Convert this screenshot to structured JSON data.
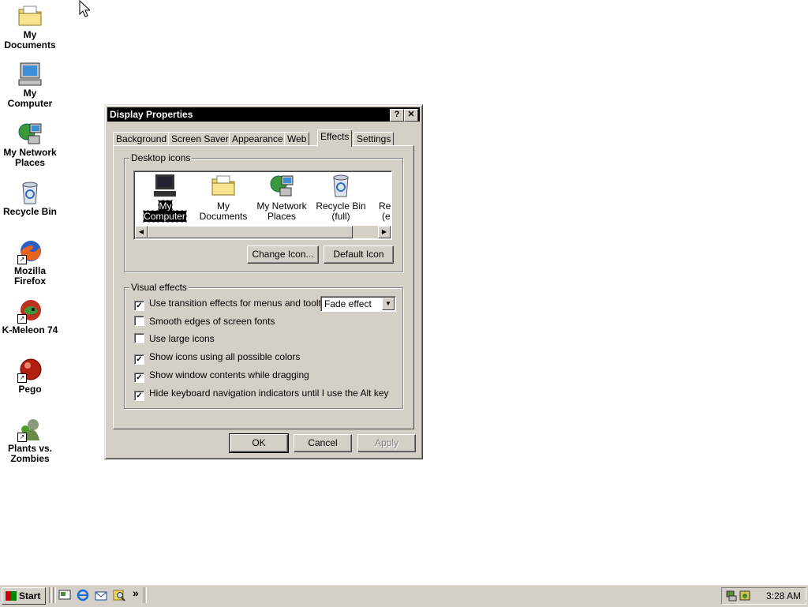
{
  "desktop": {
    "icons": [
      {
        "label_line1": "My",
        "label_line2": "Documents",
        "icon": "folder-documents-icon"
      },
      {
        "label_line1": "My",
        "label_line2": "Computer",
        "icon": "computer-icon"
      },
      {
        "label_line1": "My Network",
        "label_line2": "Places",
        "icon": "network-places-icon"
      },
      {
        "label_line1": "Recycle Bin",
        "label_line2": "",
        "icon": "recycle-bin-icon"
      },
      {
        "label_line1": "Mozilla",
        "label_line2": "Firefox",
        "icon": "firefox-icon"
      },
      {
        "label_line1": "K-Meleon 74",
        "label_line2": "",
        "icon": "kmeleon-icon"
      },
      {
        "label_line1": "Pego",
        "label_line2": "",
        "icon": "pego-icon"
      },
      {
        "label_line1": "Plants vs.",
        "label_line2": "Zombies",
        "icon": "plants-vs-zombies-icon"
      }
    ]
  },
  "dialog": {
    "title": "Display Properties",
    "help_glyph": "?",
    "close_glyph": "✕",
    "tabs": [
      "Background",
      "Screen Saver",
      "Appearance",
      "Web",
      "Effects",
      "Settings"
    ],
    "active_tab": "Effects",
    "desktop_icons": {
      "group_label": "Desktop icons",
      "items": [
        {
          "label_line1": "My Computer",
          "label_line2": "",
          "selected": true
        },
        {
          "label_line1": "My Documents",
          "label_line2": ""
        },
        {
          "label_line1": "My Network",
          "label_line2": "Places"
        },
        {
          "label_line1": "Recycle Bin",
          "label_line2": "(full)"
        },
        {
          "label_line1": "Rec",
          "label_line2": "(e"
        }
      ],
      "change_icon_label": "Change Icon...",
      "default_icon_label": "Default Icon"
    },
    "visual_effects": {
      "group_label": "Visual effects",
      "options": [
        {
          "label": "Use transition effects for menus and tooltips",
          "checked": true
        },
        {
          "label": "Smooth edges of screen fonts",
          "checked": false
        },
        {
          "label": "Use large icons",
          "checked": false
        },
        {
          "label": "Show icons using all possible colors",
          "checked": true
        },
        {
          "label": "Show window contents while dragging",
          "checked": true
        },
        {
          "label": "Hide keyboard navigation indicators until I use the Alt key",
          "checked": true
        }
      ],
      "transition_effect": "Fade effect"
    },
    "buttons": {
      "ok": "OK",
      "cancel": "Cancel",
      "apply": "Apply"
    }
  },
  "taskbar": {
    "start_label": "Start",
    "quick_launch": [
      "show-desktop-icon",
      "internet-explorer-icon",
      "outlook-express-icon",
      "search-icon"
    ],
    "more_glyph": "»",
    "clock": "3:28 AM"
  },
  "check_glyph": "✓"
}
